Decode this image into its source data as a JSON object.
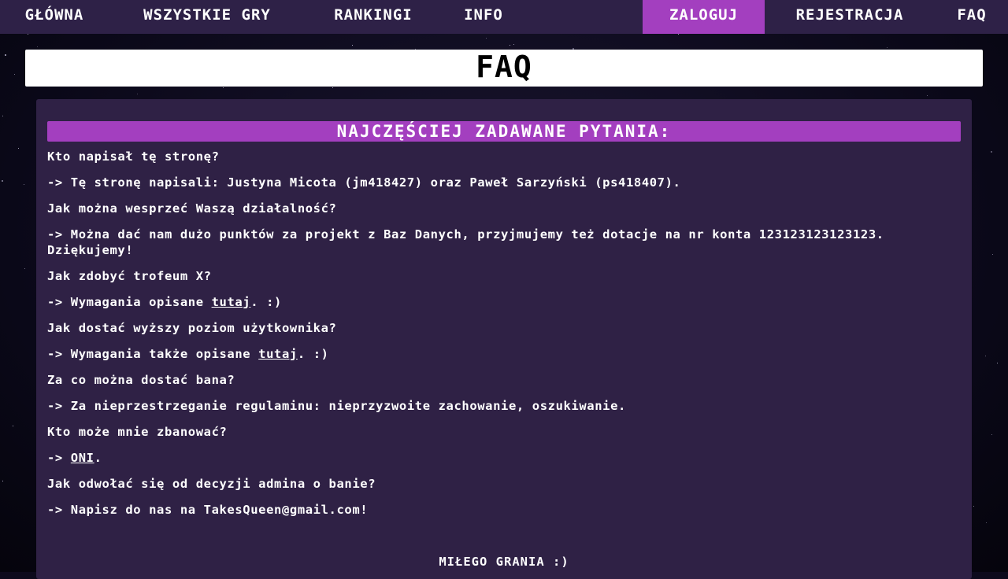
{
  "nav": {
    "left": [
      "GŁÓWNA",
      "WSZYSTKIE GRY",
      "RANKINGI",
      "INFO"
    ],
    "right": [
      "ZALOGUJ",
      "REJESTRACJA",
      "FAQ"
    ]
  },
  "page_title": "FAQ",
  "faq": {
    "heading": "NAJCZĘŚCIEJ ZADAWANE PYTANIA:",
    "items": [
      {
        "q": "Kto napisał tę stronę?",
        "a_prefix": "-> Tę stronę napisali: Justyna Micota (jm418427) oraz Paweł Sarzyński (ps418407).",
        "a_link": "",
        "a_suffix": ""
      },
      {
        "q": "Jak można wesprzeć Waszą działalność?",
        "a_prefix": "-> Można dać nam dużo punktów za projekt z Baz Danych, przyjmujemy też dotacje na nr konta 123123123123123. Dziękujemy!",
        "a_link": "",
        "a_suffix": ""
      },
      {
        "q": "Jak zdobyć trofeum X?",
        "a_prefix": "-> Wymagania opisane ",
        "a_link": "tutaj",
        "a_suffix": ". :)"
      },
      {
        "q": "Jak dostać wyższy poziom użytkownika?",
        "a_prefix": "-> Wymagania także opisane ",
        "a_link": "tutaj",
        "a_suffix": ". :)"
      },
      {
        "q": "Za co można dostać bana?",
        "a_prefix": "-> Za nieprzestrzeganie regulaminu: nieprzyzwoite zachowanie, oszukiwanie.",
        "a_link": "",
        "a_suffix": ""
      },
      {
        "q": "Kto może mnie zbanować?",
        "a_prefix": "-> ",
        "a_link": "ONI",
        "a_suffix": "."
      },
      {
        "q": "Jak odwołać się od decyzji admina o banie?",
        "a_prefix": "-> Napisz do nas na TakesQueen@gmail.com!",
        "a_link": "",
        "a_suffix": ""
      }
    ],
    "farewell": "MIŁEGO GRANIA :)"
  },
  "colors": {
    "nav_bg": "#2e2147",
    "accent": "#a33fbf",
    "panel_bg": "#2f2145",
    "title_bg": "#ffffff"
  }
}
